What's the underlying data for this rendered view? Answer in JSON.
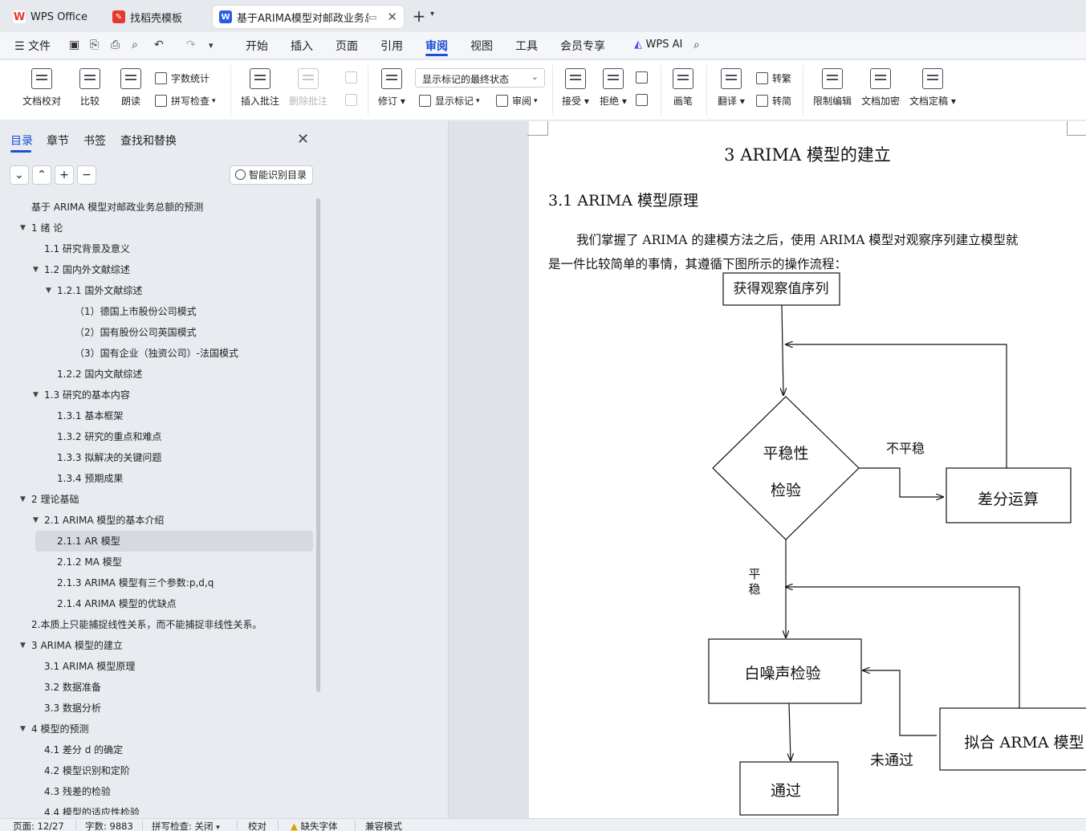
{
  "tabs": [
    {
      "label": "WPS Office",
      "icon": "wps-logo-icon"
    },
    {
      "label": "找稻壳模板",
      "icon": "docer-icon"
    },
    {
      "label": "基于ARIMA模型对邮政业务总",
      "icon": "word-doc-icon",
      "active": true
    }
  ],
  "menu": {
    "file": "文件",
    "items": [
      "开始",
      "插入",
      "页面",
      "引用",
      "审阅",
      "视图",
      "工具",
      "会员专享"
    ],
    "active": "审阅",
    "ai": "WPS AI"
  },
  "ribbon": {
    "doc_proof": "文档校对",
    "compare": "比较",
    "read_aloud": "朗读",
    "word_count": "字数统计",
    "spell_check": "拼写检查",
    "insert_comment": "插入批注",
    "delete_comment": "删除批注",
    "track_changes": "修订",
    "markup_state": "显示标记的最终状态",
    "show_markup": "显示标记",
    "review": "审阅",
    "accept": "接受",
    "reject": "拒绝",
    "pen": "画笔",
    "translate": "翻译",
    "to_traditional": "转繁",
    "to_simplified": "转简",
    "restrict_edit": "限制编辑",
    "encrypt": "文档加密",
    "finalize": "文档定稿"
  },
  "nav": {
    "tabs": [
      "目录",
      "章节",
      "书签",
      "查找和替换"
    ],
    "active": "目录",
    "smart_toc": "智能识别目录",
    "toc": [
      {
        "text": "基于 ARIMA 模型对邮政业务总额的预测",
        "level": 0,
        "arrow": false
      },
      {
        "text": "1  绪  论",
        "level": 0,
        "arrow": true
      },
      {
        "text": "1.1  研究背景及意义",
        "level": 1,
        "arrow": false
      },
      {
        "text": "1.2  国内外文献综述",
        "level": 1,
        "arrow": true
      },
      {
        "text": "1.2.1  国外文献综述",
        "level": 2,
        "arrow": true
      },
      {
        "text": "（1）德国上市股份公司模式",
        "level": 3,
        "arrow": false
      },
      {
        "text": "（2）国有股份公司英国模式",
        "level": 3,
        "arrow": false
      },
      {
        "text": "（3）国有企业（独资公司）-法国模式",
        "level": 3,
        "arrow": false
      },
      {
        "text": "1.2.2  国内文献综述",
        "level": 2,
        "arrow": false
      },
      {
        "text": "1.3  研究的基本内容",
        "level": 1,
        "arrow": true
      },
      {
        "text": "1.3.1  基本框架",
        "level": 2,
        "arrow": false
      },
      {
        "text": "1.3.2  研究的重点和难点",
        "level": 2,
        "arrow": false
      },
      {
        "text": "1.3.3  拟解决的关键问题",
        "level": 2,
        "arrow": false
      },
      {
        "text": "1.3.4  预期成果",
        "level": 2,
        "arrow": false
      },
      {
        "text": "2  理论基础",
        "level": 0,
        "arrow": true
      },
      {
        "text": "2.1    ARIMA 模型的基本介绍",
        "level": 1,
        "arrow": true
      },
      {
        "text": "2.1.1    AR 模型",
        "level": 2,
        "arrow": false,
        "selected": true
      },
      {
        "text": "2.1.2    MA 模型",
        "level": 2,
        "arrow": false
      },
      {
        "text": "2.1.3 ARIMA 模型有三个参数:p,d,q",
        "level": 2,
        "arrow": false
      },
      {
        "text": "2.1.4    ARIMA 模型的优缺点",
        "level": 2,
        "arrow": false
      },
      {
        "text": "2.本质上只能捕捉线性关系，而不能捕捉非线性关系。",
        "level": 0,
        "arrow": false
      },
      {
        "text": "3 ARIMA 模型的建立",
        "level": 0,
        "arrow": true
      },
      {
        "text": "3.1 ARIMA 模型原理",
        "level": 1,
        "arrow": false
      },
      {
        "text": "3.2  数据准备",
        "level": 1,
        "arrow": false
      },
      {
        "text": "3.3  数据分析",
        "level": 1,
        "arrow": false
      },
      {
        "text": "4  模型的预测",
        "level": 0,
        "arrow": true
      },
      {
        "text": "4.1  差分 d 的确定",
        "level": 1,
        "arrow": false
      },
      {
        "text": "4.2  模型识别和定阶",
        "level": 1,
        "arrow": false
      },
      {
        "text": "4.3 残差的检验",
        "level": 1,
        "arrow": false
      },
      {
        "text": "4.4 模型的适应性检验",
        "level": 1,
        "arrow": false
      }
    ]
  },
  "document": {
    "heading": "3 ARIMA 模型的建立",
    "subheading": "3.1 ARIMA 模型原理",
    "para_line1": "我们掌握了 ARIMA 的建模方法之后，使用 ARIMA 模型对观察序列建立模型就",
    "para_line2": "是一件比较简单的事情，其遵循下图所示的操作流程：",
    "flow": {
      "obtain": "获得观察值序列",
      "stationarity_1": "平稳性",
      "stationarity_2": "检验",
      "not_stationary": "不平稳",
      "difference": "差分运算",
      "stationary_1": "平",
      "stationary_2": "稳",
      "white_noise": "白噪声检验",
      "fit_arma": "拟合 ARMA 模型",
      "not_passed": "未通过",
      "passed": "通过"
    }
  },
  "status": {
    "page": "页面: 12/27",
    "words": "字数: 9883",
    "spell": "拼写检查: 关闭",
    "proof": "校对",
    "missing_font": "缺失字体",
    "compat": "兼容模式"
  }
}
